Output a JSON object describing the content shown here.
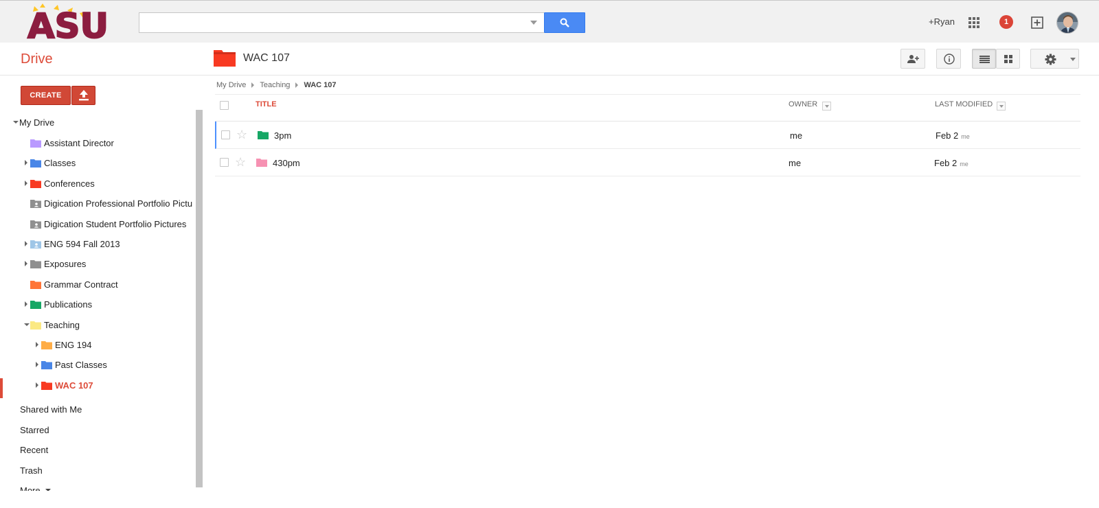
{
  "colors": {
    "brand_maroon": "#8c1d40",
    "brand_gold": "#ffc627",
    "drive_red": "#dd4b39",
    "search_blue": "#4a8af4",
    "selected_row_marker": "#4d90fe"
  },
  "header": {
    "logo_text": "ASU",
    "search": {
      "value": "",
      "placeholder": ""
    },
    "user_link": "+Ryan",
    "notification_count": "1"
  },
  "toolbar": {
    "app_title": "Drive",
    "current_folder": "WAC 107",
    "current_folder_color": "#f83a22",
    "buttons": [
      "share-icon",
      "info-icon",
      "list-view-icon",
      "grid-view-icon",
      "settings-icon"
    ],
    "list_view_active": true
  },
  "sidebar": {
    "create_label": "CREATE",
    "my_drive_label": "My Drive",
    "folders": [
      {
        "label": "Assistant Director",
        "color": "#b99aff",
        "depth": 1,
        "expander": "none"
      },
      {
        "label": "Classes",
        "color": "#4986e7",
        "depth": 1,
        "expander": "collapsed"
      },
      {
        "label": "Conferences",
        "color": "#f83a22",
        "depth": 1,
        "expander": "collapsed"
      },
      {
        "label": "Digication Professional Portfolio Pictu",
        "color": "#8f8f8f",
        "depth": 1,
        "expander": "none",
        "shared": true
      },
      {
        "label": "Digication Student Portfolio Pictures",
        "color": "#8f8f8f",
        "depth": 1,
        "expander": "none",
        "shared": true
      },
      {
        "label": "ENG 594 Fall 2013",
        "color": "#9fc6e7",
        "depth": 1,
        "expander": "collapsed",
        "shared": true
      },
      {
        "label": "Exposures",
        "color": "#8f8f8f",
        "depth": 1,
        "expander": "collapsed"
      },
      {
        "label": "Grammar Contract",
        "color": "#ff7537",
        "depth": 1,
        "expander": "none"
      },
      {
        "label": "Publications",
        "color": "#16a765",
        "depth": 1,
        "expander": "collapsed"
      },
      {
        "label": "Teaching",
        "color": "#fbe983",
        "depth": 1,
        "expander": "expanded"
      },
      {
        "label": "ENG 194",
        "color": "#ffad46",
        "depth": 2,
        "expander": "collapsed"
      },
      {
        "label": "Past Classes",
        "color": "#4986e7",
        "depth": 2,
        "expander": "collapsed"
      },
      {
        "label": "WAC 107",
        "color": "#f83a22",
        "depth": 2,
        "expander": "collapsed",
        "active": true
      }
    ],
    "nav": [
      "Shared with Me",
      "Starred",
      "Recent",
      "Trash"
    ],
    "more_label": "More"
  },
  "breadcrumb": [
    "My Drive",
    "Teaching",
    "WAC 107"
  ],
  "file_list": {
    "columns": {
      "title": "TITLE",
      "owner": "OWNER",
      "modified": "LAST MODIFIED"
    },
    "rows": [
      {
        "name": "3pm",
        "color": "#16a765",
        "owner": "me",
        "modified": "Feb 2",
        "modified_by": "me",
        "selected": true
      },
      {
        "name": "430pm",
        "color": "#f691b2",
        "owner": "me",
        "modified": "Feb 2",
        "modified_by": "me",
        "selected": false
      }
    ]
  }
}
